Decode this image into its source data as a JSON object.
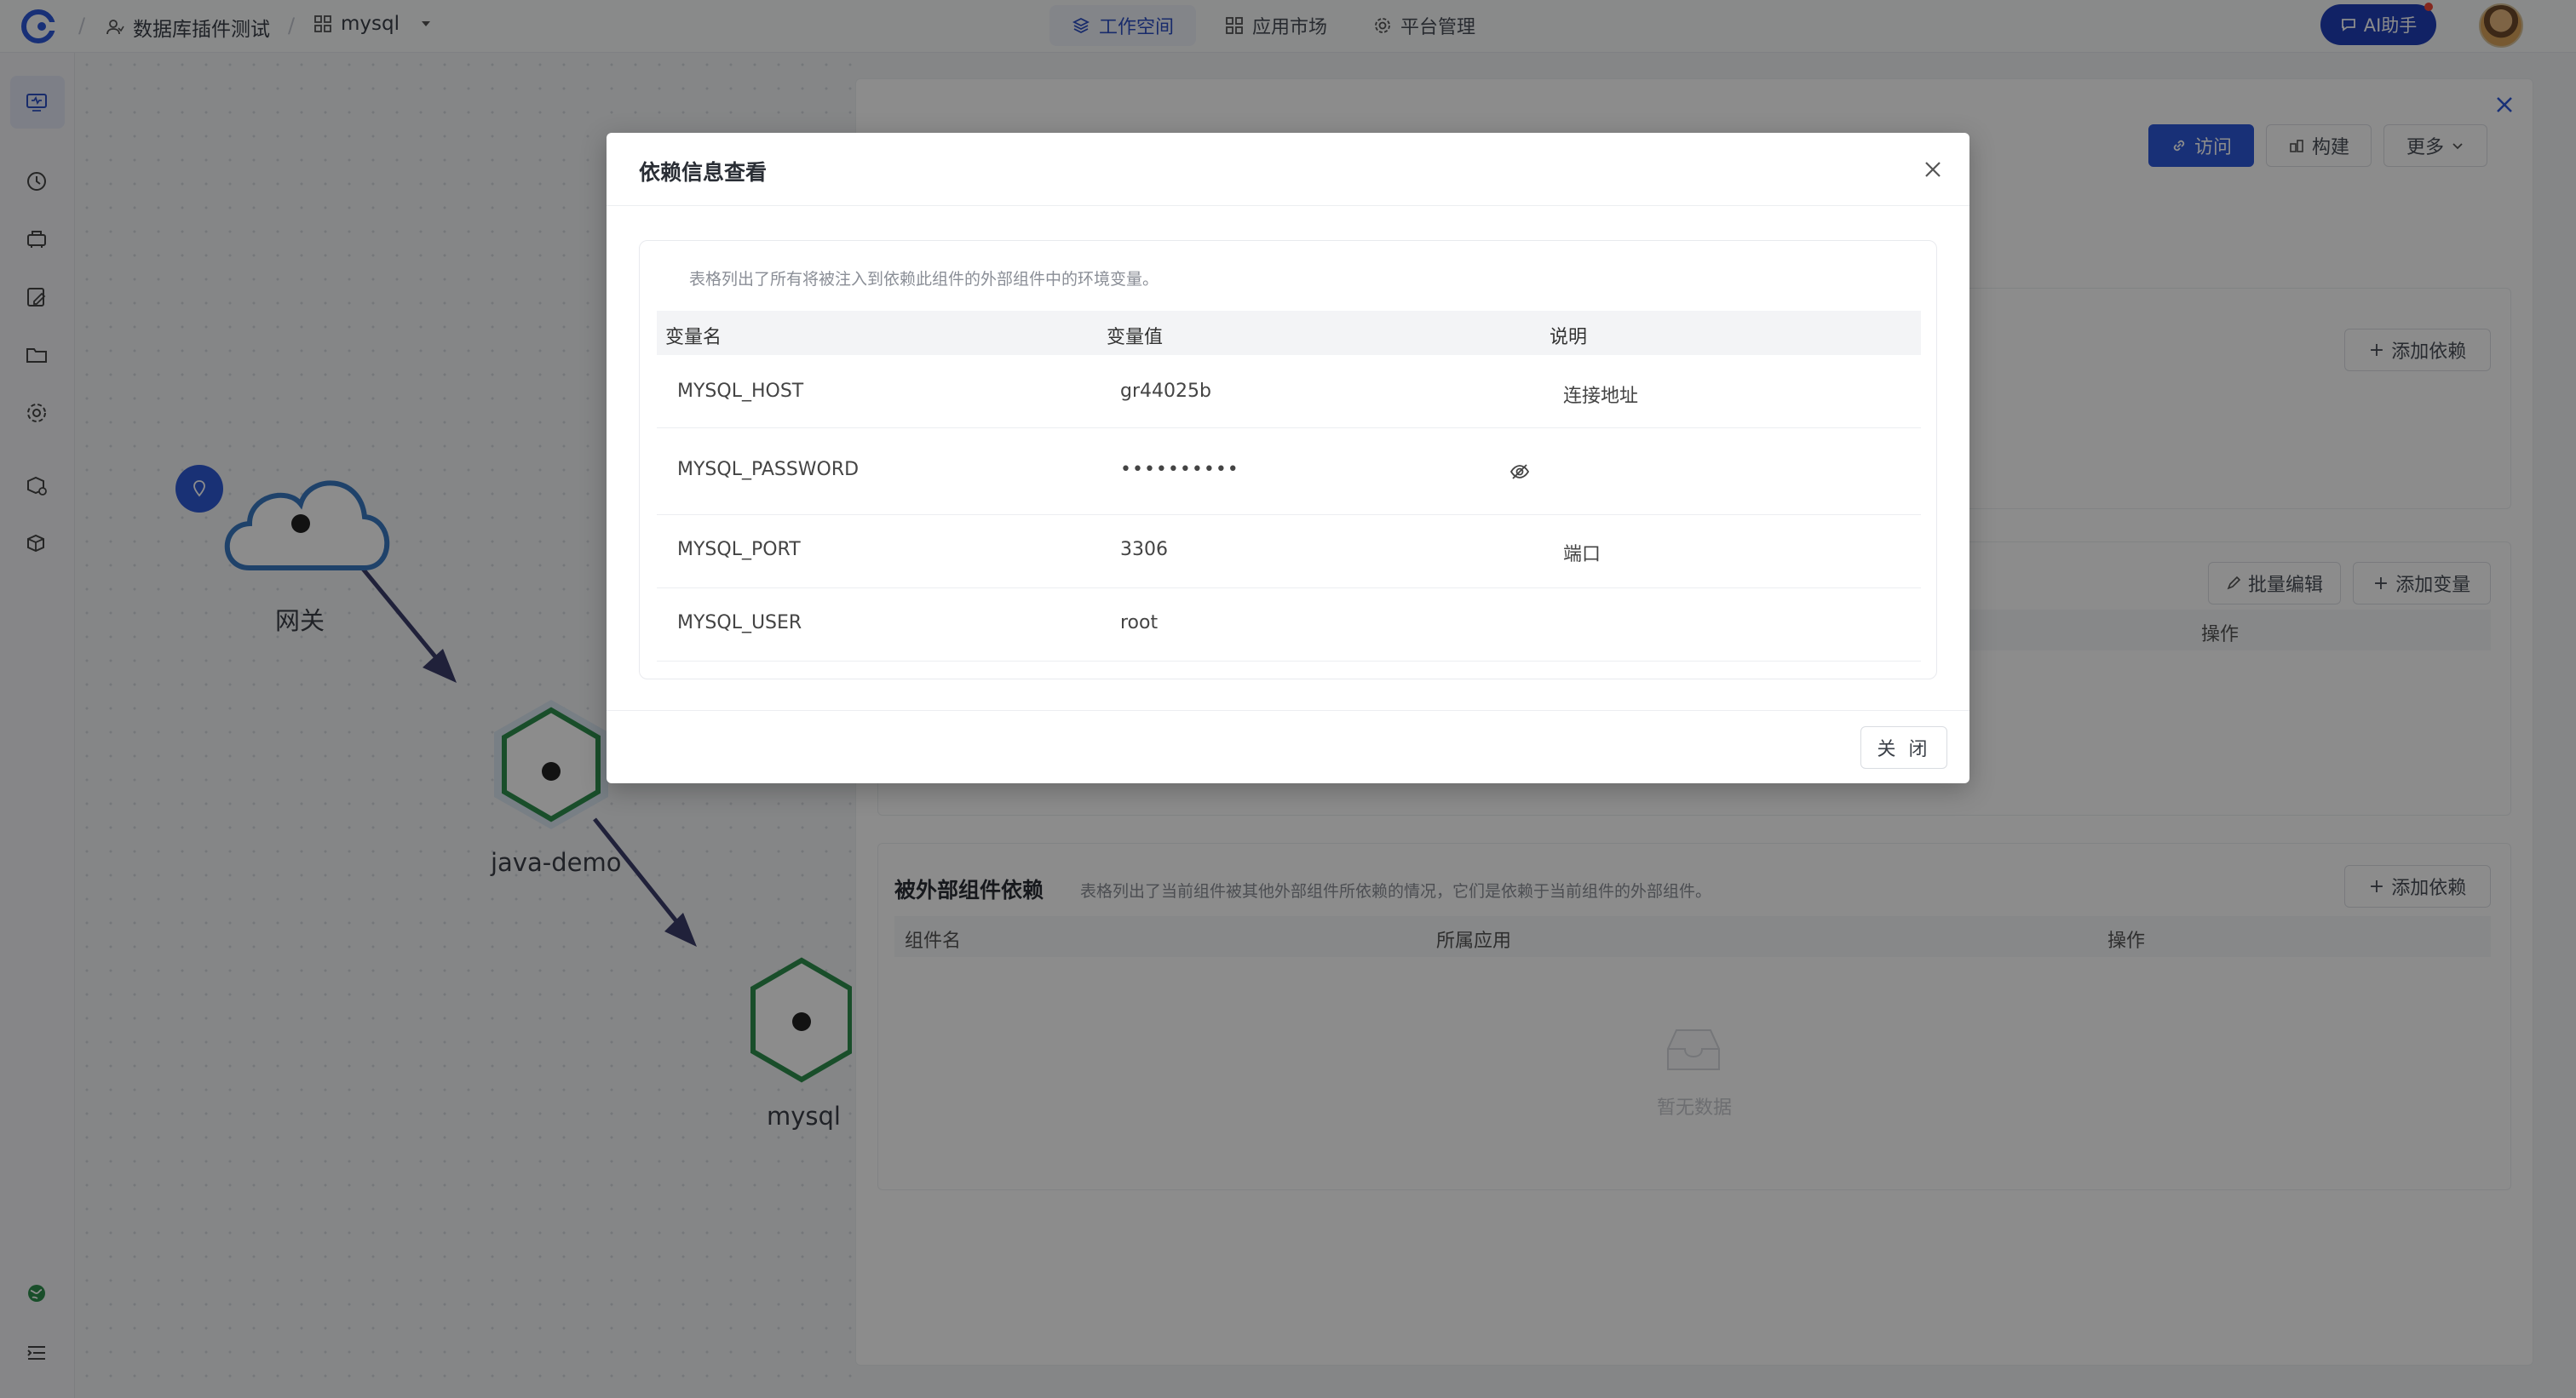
{
  "header": {
    "breadcrumb_team": "数据库插件测试",
    "breadcrumb_app": "mysql",
    "nav": [
      {
        "label": "工作空间",
        "icon": "layers-icon",
        "active": true
      },
      {
        "label": "应用市场",
        "icon": "grid-icon",
        "active": false
      },
      {
        "label": "平台管理",
        "icon": "gear-icon",
        "active": false
      }
    ],
    "ai_label": "AI助手"
  },
  "topology": {
    "nodes": [
      {
        "label": "网关",
        "type": "cloud"
      },
      {
        "label": "java-demo",
        "type": "hexagon"
      },
      {
        "label": "mysql",
        "type": "hexagon"
      }
    ]
  },
  "panel": {
    "visit_label": "访问",
    "build_label": "构建",
    "more_label": "更多",
    "add_dependency_label": "添加依赖",
    "batch_edit_label": "批量编辑",
    "add_variable_label": "添加变量",
    "env_operation_header": "操作",
    "external": {
      "title": "被外部组件依赖",
      "description": "表格列出了当前组件被其他外部组件所依赖的情况，它们是依赖于当前组件的外部组件。",
      "add_label": "添加依赖",
      "columns": [
        "组件名",
        "所属应用",
        "操作"
      ],
      "empty_text": "暂无数据"
    }
  },
  "modal": {
    "title": "依赖信息查看",
    "description": "表格列出了所有将被注入到依赖此组件的外部组件中的环境变量。",
    "columns": {
      "name": "变量名",
      "value": "变量值",
      "note": "说明"
    },
    "rows": [
      {
        "name": "MYSQL_HOST",
        "value": "gr44025b",
        "note": "连接地址"
      },
      {
        "name": "MYSQL_PASSWORD",
        "value": "••••••••••",
        "note": ""
      },
      {
        "name": "MYSQL_PORT",
        "value": "3306",
        "note": "端口"
      },
      {
        "name": "MYSQL_USER",
        "value": "root",
        "note": ""
      }
    ],
    "close_label": "关 闭"
  },
  "colors": {
    "primary": "#2d58d9",
    "ai_button": "#1f3fb8",
    "node_green": "#2f8f4e",
    "cloud_blue": "#3a78c2",
    "edge": "#3b3d6b"
  }
}
